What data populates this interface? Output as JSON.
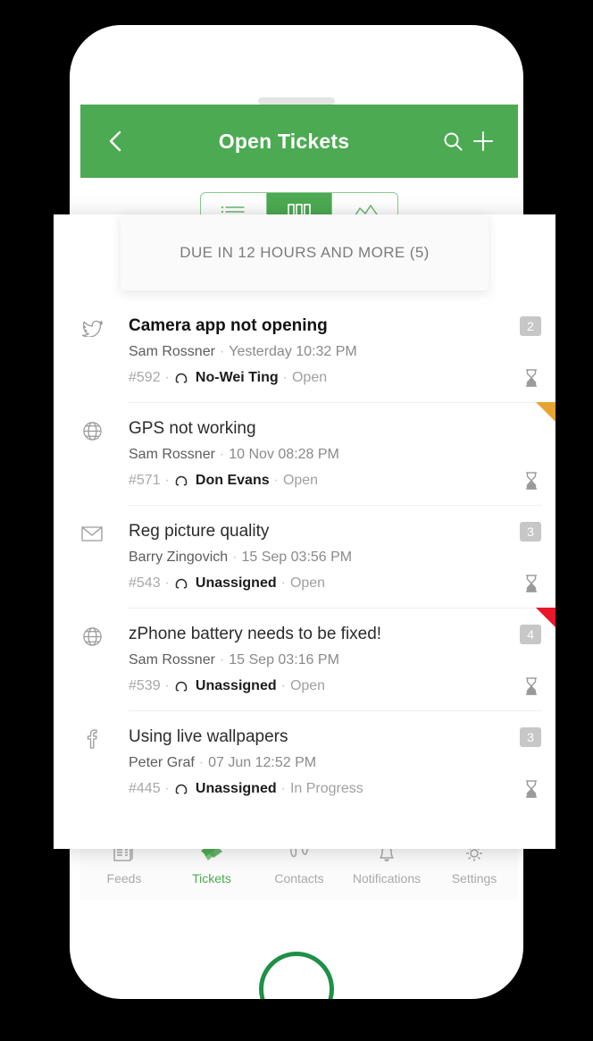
{
  "colors": {
    "brand_green": "#4caa52",
    "home_button_green": "#1f9047",
    "flag_orange": "#e8a433",
    "flag_red": "#e8182a",
    "badge_gray": "#c7c7c7",
    "background": "#000000"
  },
  "header": {
    "title": "Open Tickets",
    "back_icon": "chevron-left-icon",
    "search_icon": "search-icon",
    "add_icon": "plus-icon"
  },
  "segmented_control": {
    "options": [
      {
        "id": "list-view",
        "icon": "list-view-icon",
        "active": false
      },
      {
        "id": "kanban-view",
        "icon": "kanban-view-icon",
        "active": true
      },
      {
        "id": "chart-view",
        "icon": "chart-view-icon",
        "active": false
      }
    ]
  },
  "sheet": {
    "header_title": "DUE IN 12 HOURS AND MORE (5)"
  },
  "tickets": [
    {
      "channel_icon": "twitter-icon",
      "title": "Camera app not opening",
      "unread": true,
      "count": "2",
      "requester": "Sam Rossner",
      "date": "Yesterday 10:32 PM",
      "id": "#592",
      "assignee": "No-Wei Ting",
      "status": "Open",
      "due_icon": "hourglass-icon",
      "flag": ""
    },
    {
      "channel_icon": "globe-icon",
      "title": "GPS not working",
      "unread": false,
      "count": "",
      "requester": "Sam Rossner",
      "date": "10 Nov 08:28 PM",
      "id": "#571",
      "assignee": "Don Evans",
      "status": "Open",
      "due_icon": "hourglass-icon",
      "flag": "orange"
    },
    {
      "channel_icon": "mail-icon",
      "title": "Reg picture quality",
      "unread": false,
      "count": "3",
      "requester": "Barry Zingovich",
      "date": "15 Sep 03:56 PM",
      "id": "#543",
      "assignee": "Unassigned",
      "status": "Open",
      "due_icon": "hourglass-icon",
      "flag": ""
    },
    {
      "channel_icon": "globe-icon",
      "title": "zPhone battery needs to be fixed!",
      "unread": false,
      "count": "4",
      "requester": "Sam Rossner",
      "date": "15 Sep 03:16 PM",
      "id": "#539",
      "assignee": "Unassigned",
      "status": "Open",
      "due_icon": "hourglass-icon",
      "flag": "red"
    },
    {
      "channel_icon": "facebook-icon",
      "title": "Using live wallpapers",
      "unread": false,
      "count": "3",
      "requester": "Peter Graf",
      "date": "07 Jun 12:52 PM",
      "id": "#445",
      "assignee": "Unassigned",
      "status": "In Progress",
      "due_icon": "hourglass-icon",
      "flag": ""
    }
  ],
  "tabbar": [
    {
      "label": "Feeds",
      "icon": "feeds-icon",
      "active": false
    },
    {
      "label": "Tickets",
      "icon": "tickets-icon",
      "active": true
    },
    {
      "label": "Contacts",
      "icon": "contacts-icon",
      "active": false
    },
    {
      "label": "Notifications",
      "icon": "notifications-icon",
      "active": false
    },
    {
      "label": "Settings",
      "icon": "settings-icon",
      "active": false
    }
  ]
}
